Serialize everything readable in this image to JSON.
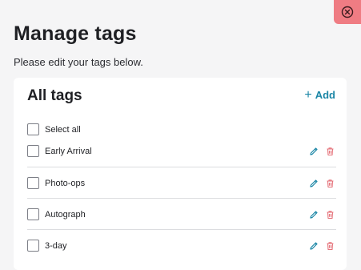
{
  "page": {
    "title": "Manage tags",
    "subtitle": "Please edit your tags below."
  },
  "card": {
    "title": "All tags",
    "add_label": "Add",
    "select_all_label": "Select all"
  },
  "tags": [
    {
      "label": "Early Arrival"
    },
    {
      "label": "Photo-ops"
    },
    {
      "label": "Autograph"
    },
    {
      "label": "3-day"
    }
  ],
  "colors": {
    "accent": "#1b86a6",
    "danger": "#e5727a",
    "close_bg": "#ef7c83"
  },
  "icons": [
    "close-icon",
    "plus-icon",
    "pencil-icon",
    "trash-icon"
  ]
}
